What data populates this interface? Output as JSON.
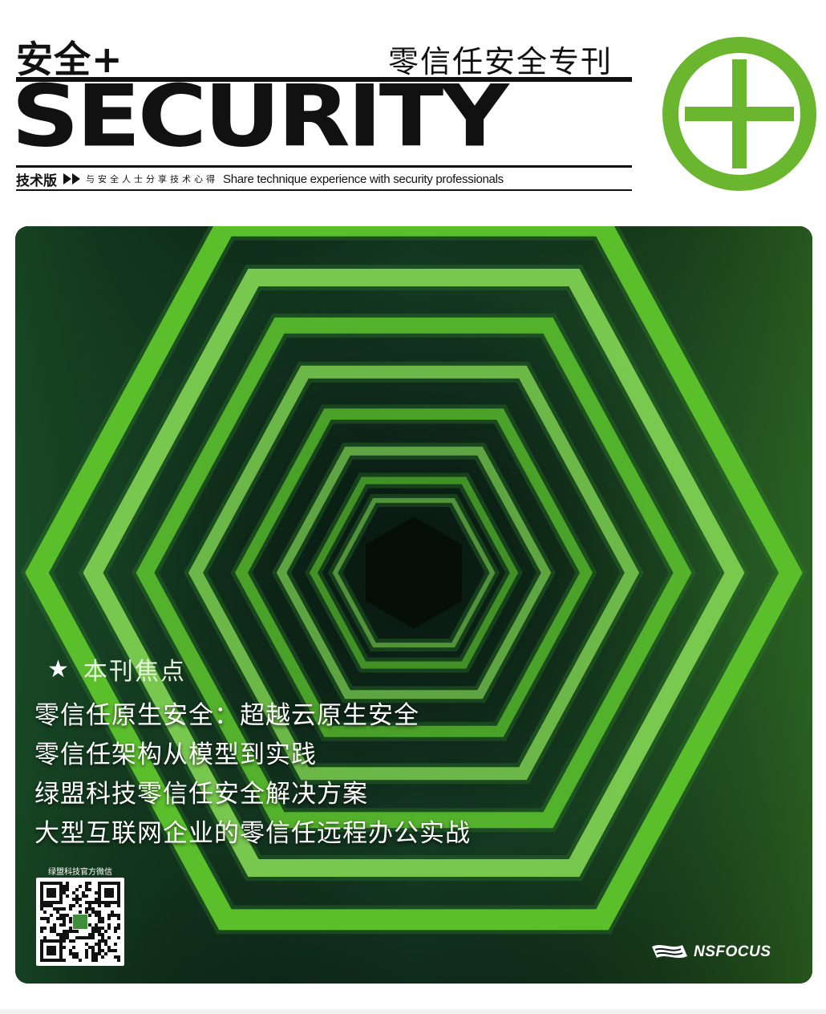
{
  "masthead": {
    "brand_cn": "安全+",
    "special_title": "零信任安全专刊",
    "wordmark": "SECURITY",
    "edition": "技术版",
    "slogan_cn": "与安全人士分享技术心得",
    "slogan_en": "Share technique experience with security professionals",
    "logo_icon": "plus-circle-icon",
    "accent_color": "#6ab72f"
  },
  "cover": {
    "focus_label": "本刊焦点",
    "headlines": [
      "零信任原生安全：超越云原生安全",
      "零信任架构从模型到实践",
      "绿盟科技零信任安全解决方案",
      "大型互联网企业的零信任远程办公实战"
    ],
    "qr_caption": "绿盟科技官方微信",
    "company": "NSFOCUS",
    "hex_color": "#5bbf2c",
    "background_color": "#0b1f16"
  }
}
